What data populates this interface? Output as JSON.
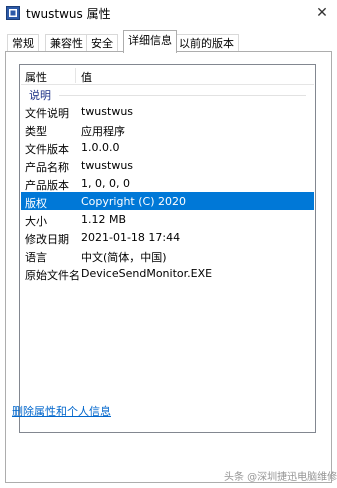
{
  "window": {
    "title": "twustwus 属性",
    "close_glyph": "✕"
  },
  "tabs": [
    {
      "label": "常规",
      "active": false
    },
    {
      "label": "兼容性",
      "active": false
    },
    {
      "label": "安全",
      "active": false
    },
    {
      "label": "详细信息",
      "active": true
    },
    {
      "label": "以前的版本",
      "active": false
    }
  ],
  "details": {
    "columns": {
      "property": "属性",
      "value": "值"
    },
    "group_label": "说明",
    "rows": [
      {
        "key": "文件说明",
        "value": "twustwus",
        "selected": false
      },
      {
        "key": "类型",
        "value": "应用程序",
        "selected": false
      },
      {
        "key": "文件版本",
        "value": "1.0.0.0",
        "selected": false
      },
      {
        "key": "产品名称",
        "value": "twustwus",
        "selected": false
      },
      {
        "key": "产品版本",
        "value": "1, 0, 0, 0",
        "selected": false
      },
      {
        "key": "版权",
        "value": "Copyright (C) 2020",
        "selected": true
      },
      {
        "key": "大小",
        "value": "1.12 MB",
        "selected": false
      },
      {
        "key": "修改日期",
        "value": "2021-01-18 17:44",
        "selected": false
      },
      {
        "key": "语言",
        "value": "中文(简体，中国)",
        "selected": false
      },
      {
        "key": "原始文件名",
        "value": "DeviceSendMonitor.EXE",
        "selected": false
      }
    ]
  },
  "footer": {
    "remove_properties_link": "删除属性和个人信息"
  },
  "watermark": "头条 @深圳捷迅电脑维修"
}
